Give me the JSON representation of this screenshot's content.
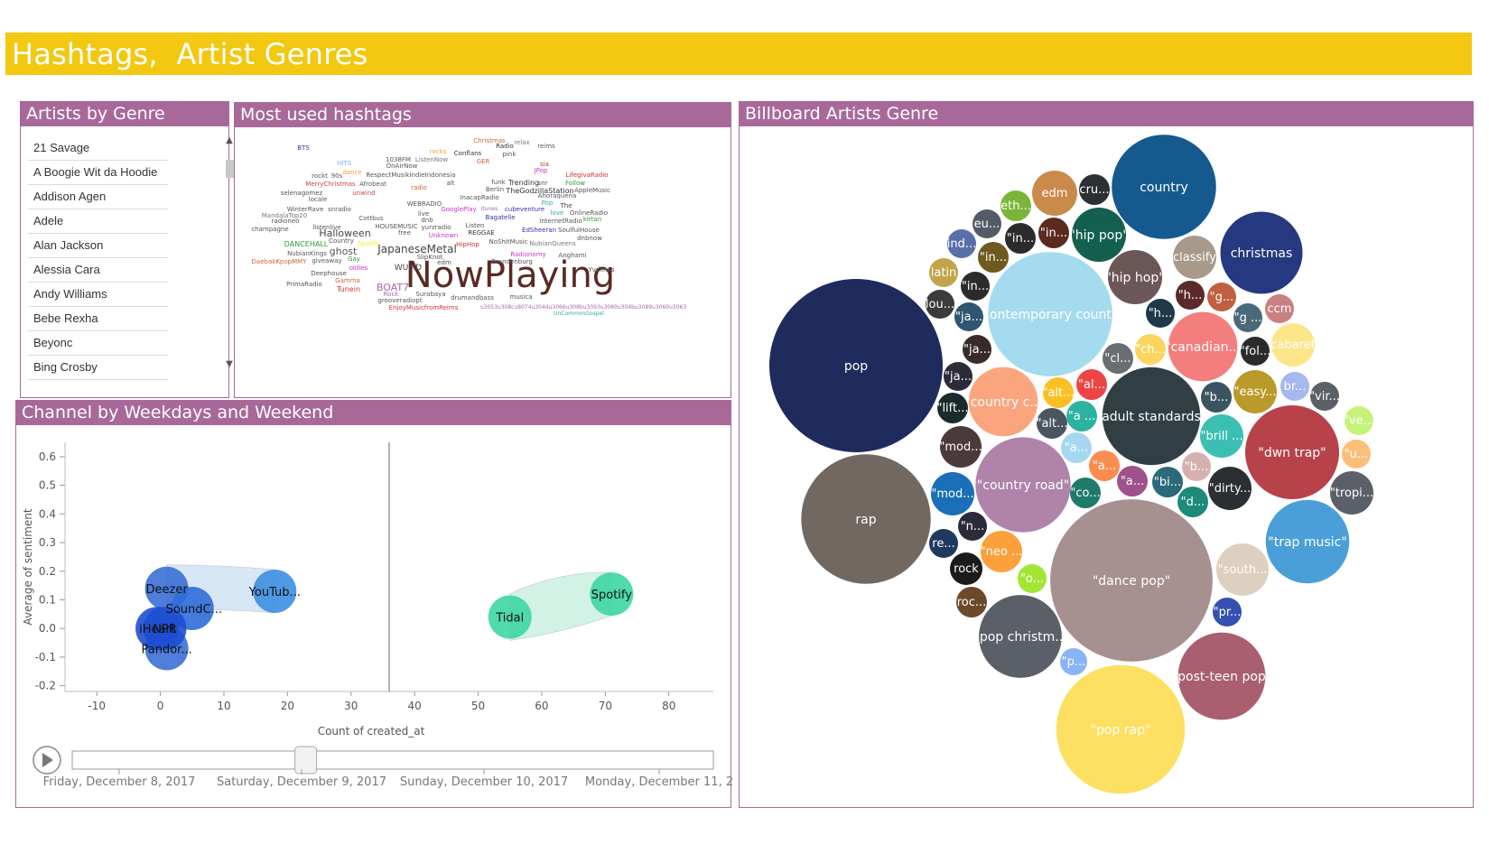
{
  "page": {
    "title": "Hashtags,  Artist Genres"
  },
  "panels": {
    "artists": "Artists by Genre",
    "hashtags": "Most used hashtags",
    "channel": "Channel by Weekdays and Weekend",
    "billboard": "Billboard Artists Genre"
  },
  "artist_list": [
    "21 Savage",
    "A Boogie Wit da Hoodie",
    "Addison Agen",
    "Adele",
    "Alan Jackson",
    "Alessia Cara",
    "Andy Williams",
    "Bebe Rexha",
    "Beyonc",
    "Bing Crosby"
  ],
  "colors": {
    "banner": "#f2c811",
    "panel": "#a8699a"
  },
  "wordcloud": [
    {
      "t": "NowPlaying",
      "x": 565,
      "y": 318,
      "s": 40,
      "c": "#5a2a22"
    },
    {
      "t": "JapaneseMetal",
      "x": 462,
      "y": 280,
      "s": 12,
      "c": "#444"
    },
    {
      "t": "Halloween",
      "x": 382,
      "y": 262,
      "s": 11,
      "c": "#444"
    },
    {
      "t": "ghost",
      "x": 380,
      "y": 282,
      "s": 11,
      "c": "#555"
    },
    {
      "t": "BOAT7",
      "x": 435,
      "y": 322,
      "s": 11,
      "c": "#a6a"
    },
    {
      "t": "WUMD",
      "x": 452,
      "y": 299,
      "s": 9,
      "c": "#444"
    },
    {
      "t": "NubianQueens",
      "x": 612,
      "y": 272,
      "s": 7,
      "c": "#777"
    },
    {
      "t": "The",
      "x": 627,
      "y": 230,
      "s": 7,
      "c": "#444"
    },
    {
      "t": "TheGodzillaStation",
      "x": 598,
      "y": 214,
      "s": 8,
      "c": "#333"
    },
    {
      "t": "Trending",
      "x": 580,
      "y": 205,
      "s": 8,
      "c": "#333"
    },
    {
      "t": "Conflans",
      "x": 518,
      "y": 172,
      "s": 7,
      "c": "#333"
    },
    {
      "t": "ListenNow",
      "x": 478,
      "y": 179,
      "s": 7,
      "c": "#777"
    },
    {
      "t": "1038FM",
      "x": 441,
      "y": 179,
      "s": 7,
      "c": "#555"
    },
    {
      "t": "OnAirNow",
      "x": 445,
      "y": 186,
      "s": 7,
      "c": "#555"
    },
    {
      "t": "RespectMusikIndieIndonesia",
      "x": 455,
      "y": 196,
      "s": 7,
      "c": "#555"
    },
    {
      "t": "Afrobeat",
      "x": 413,
      "y": 206,
      "s": 7,
      "c": "#555"
    },
    {
      "t": "MerryChristmas",
      "x": 366,
      "y": 206,
      "s": 7,
      "c": "#c44"
    },
    {
      "t": "selenagomez",
      "x": 334,
      "y": 216,
      "s": 7,
      "c": "#555"
    },
    {
      "t": "unwind",
      "x": 403,
      "y": 216,
      "s": 7,
      "c": "#c44"
    },
    {
      "t": "WEBRADIO",
      "x": 470,
      "y": 228,
      "s": 7,
      "c": "#555"
    },
    {
      "t": "WinterRave",
      "x": 338,
      "y": 234,
      "s": 7,
      "c": "#555"
    },
    {
      "t": "MandalaTop20",
      "x": 315,
      "y": 241,
      "s": 7,
      "c": "#777"
    },
    {
      "t": "radioneo",
      "x": 316,
      "y": 247,
      "s": 7,
      "c": "#555"
    },
    {
      "t": "champagne",
      "x": 299,
      "y": 256,
      "s": 7,
      "c": "#555"
    },
    {
      "t": "DANCEHALL",
      "x": 339,
      "y": 273,
      "s": 8,
      "c": "#393"
    },
    {
      "t": "DaebakKpopMMY",
      "x": 309,
      "y": 292,
      "s": 7,
      "c": "#c63"
    },
    {
      "t": "PrimaRadio",
      "x": 337,
      "y": 317,
      "s": 7,
      "c": "#555"
    },
    {
      "t": "Tunein",
      "x": 386,
      "y": 323,
      "s": 8,
      "c": "#c33"
    },
    {
      "t": "Deephouse",
      "x": 364,
      "y": 305,
      "s": 7,
      "c": "#555"
    },
    {
      "t": "HOUSEMUSIC",
      "x": 439,
      "y": 253,
      "s": 7,
      "c": "#555"
    },
    {
      "t": "REGGAE",
      "x": 533,
      "y": 260,
      "s": 7,
      "c": "#333"
    },
    {
      "t": "HipHop",
      "x": 518,
      "y": 273,
      "s": 7,
      "c": "#c33"
    },
    {
      "t": "NoShitMusic",
      "x": 563,
      "y": 270,
      "s": 7,
      "c": "#555"
    },
    {
      "t": "Brandenburg",
      "x": 567,
      "y": 292,
      "s": 7,
      "c": "#555"
    },
    {
      "t": "Radionomy",
      "x": 585,
      "y": 284,
      "s": 7,
      "c": "#c3c"
    },
    {
      "t": "Anghami",
      "x": 634,
      "y": 285,
      "s": 7,
      "c": "#555"
    },
    {
      "t": "Yvelines",
      "x": 666,
      "y": 301,
      "s": 7,
      "c": "#555"
    },
    {
      "t": "EdSheeran",
      "x": 597,
      "y": 257,
      "s": 7,
      "c": "#33a"
    },
    {
      "t": "InternetRadio",
      "x": 621,
      "y": 247,
      "s": 7,
      "c": "#555"
    },
    {
      "t": "SoulfulHouse",
      "x": 641,
      "y": 257,
      "s": 7,
      "c": "#555"
    },
    {
      "t": "OnlineRadio",
      "x": 652,
      "y": 238,
      "s": 7,
      "c": "#555"
    },
    {
      "t": "kirtan",
      "x": 656,
      "y": 245,
      "s": 7,
      "c": "#393"
    },
    {
      "t": "cubeventure",
      "x": 581,
      "y": 234,
      "s": 7,
      "c": "#33a"
    },
    {
      "t": "Bagatelle",
      "x": 554,
      "y": 243,
      "s": 7,
      "c": "#33a"
    },
    {
      "t": "GooglePlay",
      "x": 508,
      "y": 234,
      "s": 7,
      "c": "#c3c"
    },
    {
      "t": "InacapRadio",
      "x": 531,
      "y": 221,
      "s": 7,
      "c": "#555"
    },
    {
      "t": "Berlin",
      "x": 548,
      "y": 212,
      "s": 7,
      "c": "#555"
    },
    {
      "t": "AppleMusic",
      "x": 656,
      "y": 213,
      "s": 7,
      "c": "#555"
    },
    {
      "t": "Follow",
      "x": 637,
      "y": 205,
      "s": 7,
      "c": "#393"
    },
    {
      "t": "LifegivaRadio",
      "x": 650,
      "y": 196,
      "s": 7,
      "c": "#c33"
    },
    {
      "t": "Radio",
      "x": 559,
      "y": 164,
      "s": 7,
      "c": "#333"
    },
    {
      "t": "Christmas",
      "x": 542,
      "y": 158,
      "s": 7,
      "c": "#c63"
    },
    {
      "t": "reims",
      "x": 605,
      "y": 164,
      "s": 7,
      "c": "#555"
    },
    {
      "t": "pink",
      "x": 564,
      "y": 173,
      "s": 7,
      "c": "#555"
    },
    {
      "t": "GER",
      "x": 535,
      "y": 181,
      "s": 7,
      "c": "#c63"
    },
    {
      "t": "SlipKnot",
      "x": 476,
      "y": 287,
      "s": 7,
      "c": "#555"
    },
    {
      "t": "edm",
      "x": 492,
      "y": 293,
      "s": 7,
      "c": "#555"
    },
    {
      "t": "Surabaya",
      "x": 477,
      "y": 328,
      "s": 7,
      "c": "#555"
    },
    {
      "t": "drumandbass",
      "x": 523,
      "y": 332,
      "s": 7,
      "c": "#555"
    },
    {
      "t": "musica",
      "x": 577,
      "y": 331,
      "s": 7,
      "c": "#555"
    },
    {
      "t": "grooveradiopt",
      "x": 443,
      "y": 335,
      "s": 7,
      "c": "#555"
    },
    {
      "t": "EnjoyMusicfromReims",
      "x": 469,
      "y": 343,
      "s": 7,
      "c": "#c33"
    },
    {
      "t": "u3053u308cu8074u3044u3066u308bu3093u3060u304bu3089u3060u3063",
      "x": 646,
      "y": 342,
      "s": 6,
      "c": "#a6a"
    },
    {
      "t": "UnCommonGospel",
      "x": 641,
      "y": 349,
      "s": 6,
      "c": "#3aa"
    },
    {
      "t": "Rock",
      "x": 433,
      "y": 328,
      "s": 7,
      "c": "#a6a"
    },
    {
      "t": "oldies",
      "x": 397,
      "y": 299,
      "s": 7,
      "c": "#c3c"
    },
    {
      "t": "Gamma",
      "x": 385,
      "y": 313,
      "s": 7,
      "c": "#c63"
    },
    {
      "t": "giveaway",
      "x": 362,
      "y": 291,
      "s": 7,
      "c": "#555"
    },
    {
      "t": "Gay",
      "x": 392,
      "y": 289,
      "s": 7,
      "c": "#393"
    },
    {
      "t": "NubianKings",
      "x": 340,
      "y": 283,
      "s": 7,
      "c": "#555"
    },
    {
      "t": "Country",
      "x": 378,
      "y": 269,
      "s": 7,
      "c": "#555"
    },
    {
      "t": "Spotify",
      "x": 408,
      "y": 272,
      "s": 7,
      "c": "#ee3"
    },
    {
      "t": "snradio",
      "x": 376,
      "y": 234,
      "s": 7,
      "c": "#555"
    },
    {
      "t": "listenlive",
      "x": 362,
      "y": 254,
      "s": 7,
      "c": "#555"
    },
    {
      "t": "Cottbus",
      "x": 411,
      "y": 244,
      "s": 7,
      "c": "#555"
    },
    {
      "t": "free",
      "x": 448,
      "y": 260,
      "s": 7,
      "c": "#555"
    },
    {
      "t": "Unknown",
      "x": 491,
      "y": 263,
      "s": 7,
      "c": "#c3c"
    },
    {
      "t": "yurzradio",
      "x": 483,
      "y": 254,
      "s": 7,
      "c": "#555"
    },
    {
      "t": "Listen",
      "x": 526,
      "y": 252,
      "s": 7,
      "c": "#555"
    },
    {
      "t": "dnb",
      "x": 473,
      "y": 246,
      "s": 7,
      "c": "#555"
    },
    {
      "t": "live",
      "x": 469,
      "y": 239,
      "s": 7,
      "c": "#555"
    },
    {
      "t": "locale",
      "x": 352,
      "y": 223,
      "s": 7,
      "c": "#555"
    },
    {
      "t": "rockt",
      "x": 354,
      "y": 197,
      "s": 7,
      "c": "#555"
    },
    {
      "t": "90s",
      "x": 373,
      "y": 197,
      "s": 7,
      "c": "#555"
    },
    {
      "t": "dance",
      "x": 390,
      "y": 193,
      "s": 7,
      "c": "#f93"
    },
    {
      "t": "HITS",
      "x": 381,
      "y": 183,
      "s": 7,
      "c": "#7af"
    },
    {
      "t": "radio",
      "x": 464,
      "y": 210,
      "s": 7,
      "c": "#c63"
    },
    {
      "t": "rocks",
      "x": 485,
      "y": 170,
      "s": 7,
      "c": "#f93"
    },
    {
      "t": "relax",
      "x": 578,
      "y": 160,
      "s": 7,
      "c": "#777"
    },
    {
      "t": "sia",
      "x": 603,
      "y": 184,
      "s": 7,
      "c": "#c33"
    },
    {
      "t": "JPop",
      "x": 599,
      "y": 191,
      "s": 7,
      "c": "#c3c"
    },
    {
      "t": "funk",
      "x": 552,
      "y": 204,
      "s": 7,
      "c": "#555"
    },
    {
      "t": "alt",
      "x": 499,
      "y": 205,
      "s": 7,
      "c": "#555"
    },
    {
      "t": "snr",
      "x": 601,
      "y": 205,
      "s": 7,
      "c": "#555"
    },
    {
      "t": "Ahoraquena",
      "x": 617,
      "y": 219,
      "s": 7,
      "c": "#555"
    },
    {
      "t": "Pop",
      "x": 606,
      "y": 227,
      "s": 7,
      "c": "#3aa"
    },
    {
      "t": "love",
      "x": 617,
      "y": 238,
      "s": 7,
      "c": "#3aa"
    },
    {
      "t": "itunes",
      "x": 542,
      "y": 233,
      "s": 6,
      "c": "#a6a"
    },
    {
      "t": "dnbnow",
      "x": 653,
      "y": 266,
      "s": 7,
      "c": "#555"
    },
    {
      "t": "BTS",
      "x": 336,
      "y": 166,
      "s": 7,
      "c": "#33a"
    }
  ],
  "chart_data": [
    {
      "type": "scatter",
      "xlabel": "Count of created_at",
      "ylabel": "Average of sentiment",
      "xlim": [
        -15,
        87
      ],
      "ylim": [
        -0.22,
        0.65
      ],
      "xticks": [
        -10,
        0,
        10,
        20,
        30,
        40,
        50,
        60,
        70,
        80
      ],
      "yticks": [
        0.6,
        0.5,
        0.4,
        0.3,
        0.2,
        0.1,
        0.0,
        -0.1,
        -0.2
      ],
      "ytick_labels": [
        "0.6",
        "0.5",
        "0.4",
        "0.3",
        "0.2",
        "0.1",
        "0.0",
        "-0.1",
        "-0.2"
      ],
      "reference_x": 36,
      "points": [
        {
          "name": "Deezer",
          "x": 1,
          "y": 0.14,
          "color": "#3b6fd6"
        },
        {
          "name": "SoundC...",
          "x": 5,
          "y": 0.07,
          "color": "#2f6dd8"
        },
        {
          "name": "Pandor...",
          "x": 1,
          "y": -0.07,
          "color": "#3b6fd6"
        },
        {
          "name": "NPR",
          "x": 0.7,
          "y": 0.0,
          "color": "#1e4fd2"
        },
        {
          "name": "iHeart",
          "x": -0.5,
          "y": 0.0,
          "color": "#1e4fd2"
        },
        {
          "name": "YouTub...",
          "x": 18,
          "y": 0.13,
          "color": "#3d8fe0"
        },
        {
          "name": "Tidal",
          "x": 55,
          "y": 0.04,
          "color": "#3ed6a3"
        },
        {
          "name": "Spotify",
          "x": 71,
          "y": 0.12,
          "color": "#3ed6a3"
        }
      ],
      "trails": [
        {
          "from": "Deezer",
          "to": "YouTub...",
          "color": "#cfe2f5"
        },
        {
          "from": "Tidal",
          "to": "Spotify",
          "color": "#c9f0e1"
        }
      ],
      "play_axis": {
        "labels": [
          "Friday, December 8, 2017",
          "Saturday, December 9, 2017",
          "Sunday, December 10, 2017",
          "Monday, December 11, 2"
        ],
        "position": 0.36
      }
    },
    {
      "type": "bubble",
      "items": [
        {
          "label": "country",
          "v": 100,
          "color": "#155a8f"
        },
        {
          "label": "christmas",
          "v": 62,
          "color": "#26387f"
        },
        {
          "label": "pop",
          "v": 276,
          "color": "#1e2b5c"
        },
        {
          "label": "rap",
          "v": 154,
          "color": "#716861"
        },
        {
          "label": "\"contemporary count...",
          "v": 142,
          "color": "#a5dbee"
        },
        {
          "label": "\"dance pop\"",
          "v": 242,
          "color": "#a79090"
        },
        {
          "label": "\"pop rap\"",
          "v": 152,
          "color": "#fde061"
        },
        {
          "label": "\"adult standards\"",
          "v": 88,
          "color": "#313f44"
        },
        {
          "label": "\"country road\"",
          "v": 83,
          "color": "#b083ab"
        },
        {
          "label": "\"dwn trap\"",
          "v": 81,
          "color": "#b7424a"
        },
        {
          "label": "\"trap music\"",
          "v": 64,
          "color": "#4a9fd8"
        },
        {
          "label": "\"post-teen pop\"",
          "v": 70,
          "color": "#a95f70"
        },
        {
          "label": "\"pop christm...",
          "v": 63,
          "color": "#5b5f68"
        },
        {
          "label": "\"canadian...",
          "v": 44,
          "color": "#f47d7d"
        },
        {
          "label": "\"country c...",
          "v": 44,
          "color": "#fba57e"
        },
        {
          "label": "\"hip pop\"",
          "v": 27,
          "color": "#14604f"
        },
        {
          "label": "\"hip hop\"",
          "v": 27,
          "color": "#6c5758"
        }
      ]
    }
  ],
  "bubbles_small": [
    [
      "edm",
      "#c98a4b"
    ],
    [
      "cru...",
      "#2c2f33"
    ],
    [
      "eth...",
      "#7ab53a"
    ],
    [
      "eu...",
      "#555b66"
    ],
    [
      "\"in...",
      "#2b2b2b"
    ],
    [
      "\"in...",
      "#5a2a1e"
    ],
    [
      "ind...",
      "#5a6fa8"
    ],
    [
      "\"in...",
      "#6e5a1e"
    ],
    [
      "latin",
      "#c3a44b"
    ],
    [
      "\"in...",
      "#2b2b2b"
    ],
    [
      "lou...",
      "#3b3b3b"
    ],
    [
      "\"ja...",
      "#2e5670"
    ],
    [
      "\"ja...",
      "#3a2b2b"
    ],
    [
      "\"ja...",
      "#2b2b3a"
    ],
    [
      "\"lift...",
      "#1b2a2a"
    ],
    [
      "\"mod...",
      "#4a3a3a"
    ],
    [
      "\"mod...",
      "#1b6fb8"
    ],
    [
      "\"n...",
      "#2b2b3a"
    ],
    [
      "re...",
      "#1e3a5f"
    ],
    [
      "rock",
      "#1b1b1b"
    ],
    [
      "roc...",
      "#6b4a2b"
    ],
    [
      "\"neo ...",
      "#fba03a"
    ],
    [
      "\"o...",
      "#a3e635"
    ],
    [
      "\"p...",
      "#8ab4f8"
    ],
    [
      "\"pr...",
      "#3550b0"
    ],
    [
      "\"south...",
      "#ddd0c0"
    ],
    [
      "\"tropi...",
      "#5b6068"
    ],
    [
      "\"u...",
      "#fbbf7a"
    ],
    [
      "\"ve...",
      "#c7f27a"
    ],
    [
      "\"vir...",
      "#5b6068"
    ],
    [
      "br...",
      "#a5b8f0"
    ],
    [
      "\"easy...",
      "#b99a2a"
    ],
    [
      "cabaret",
      "#fde68a"
    ],
    [
      "ccm",
      "#c98080"
    ],
    [
      "\"fol...",
      "#2b2b2b"
    ],
    [
      "\"g ...",
      "#4a6a7a"
    ],
    [
      "\"g...",
      "#c06040"
    ],
    [
      "\"h...",
      "#5a2a2a"
    ],
    [
      "\"h...",
      "#1e3a4a"
    ],
    [
      "classify",
      "#a89a8a"
    ],
    [
      "\"ch...",
      "#fbd560"
    ],
    [
      "\"cl...",
      "#6a6e70"
    ],
    [
      "\"al...",
      "#ef4444"
    ],
    [
      "\"alt...",
      "#fbbf24"
    ],
    [
      "\"alt...",
      "#4a5560"
    ],
    [
      "\"a ...",
      "#2bb3a0"
    ],
    [
      "\"a...",
      "#a5d8f0"
    ],
    [
      "\"a...",
      "#fb8c50"
    ],
    [
      "\"a...",
      "#a0508a"
    ],
    [
      "\"bi...",
      "#2b6a7a"
    ],
    [
      "\"b...",
      "#d6b0b0"
    ],
    [
      "\"b...",
      "#3a5560"
    ],
    [
      "\"brill ...",
      "#3bbfb3"
    ],
    [
      "\"co...",
      "#1e7a6a"
    ],
    [
      "\"d...",
      "#1e8a7a"
    ],
    [
      "\"dirty...",
      "#2b2f33"
    ]
  ]
}
